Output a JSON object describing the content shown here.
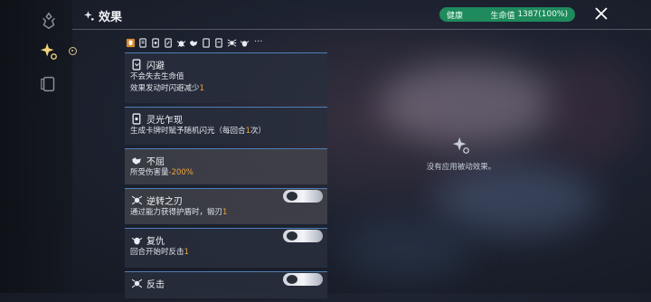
{
  "header": {
    "title": "效果",
    "hp_label": "健康",
    "hp_value_label": "生命值",
    "hp_value": "1387(100%)"
  },
  "tray": {
    "more": "···"
  },
  "effects": [
    {
      "icon": "dodge-icon",
      "title": "闪避",
      "lines": [
        [
          "不会失去生命值"
        ],
        [
          "效果发动时闪避减少",
          "1"
        ]
      ]
    },
    {
      "icon": "card-flash-icon",
      "title": "灵光乍现",
      "lines": [
        [
          "生成卡牌时赋予随机闪光（每回合",
          "1",
          "次）"
        ]
      ]
    },
    {
      "icon": "wolf-icon",
      "title": "不屈",
      "lines": [
        [
          "所受伤害量",
          "-200%",
          ""
        ]
      ]
    },
    {
      "icon": "spider-icon",
      "title": "逆转之刃",
      "lines": [
        [
          "通过能力获得护盾时，锻刃",
          "1"
        ]
      ]
    },
    {
      "icon": "beetle-icon",
      "title": "复仇",
      "lines": [
        [
          "回合开始时反击",
          "1"
        ]
      ]
    },
    {
      "icon": "spider-icon",
      "title": "反击",
      "lines": []
    }
  ],
  "empty_panel": {
    "text": "没有应用被动效果。"
  },
  "colors": {
    "accent_blue": "#4d7fb8",
    "highlight_orange": "#f3a63a",
    "hp_green": "#1f8a5c"
  }
}
